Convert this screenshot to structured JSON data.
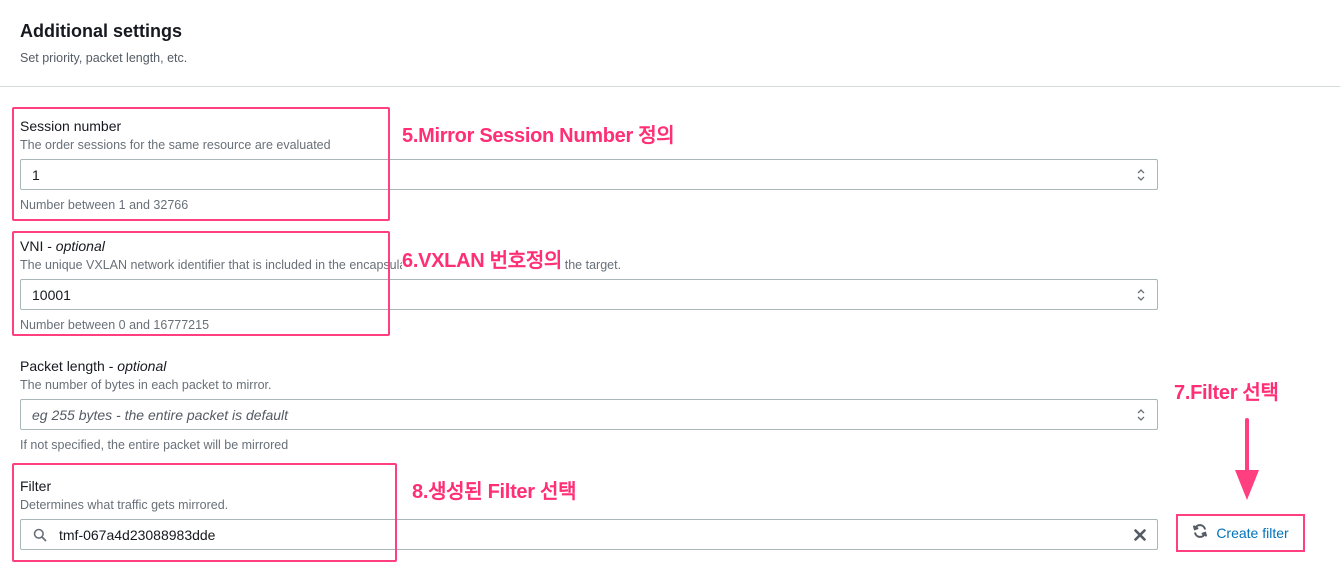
{
  "section": {
    "title": "Additional settings",
    "description": "Set priority, packet length, etc."
  },
  "session_number": {
    "label": "Session number",
    "description": "The order sessions for the same resource are evaluated",
    "value": "1",
    "hint": "Number between 1 and 32766"
  },
  "vni": {
    "label": "VNI",
    "optional": "optional",
    "description": "The unique VXLAN network identifier that is included in the encapsulated mirrored packets sent to the target.",
    "value": "10001",
    "hint": "Number between 0 and 16777215"
  },
  "packet_length": {
    "label": "Packet length",
    "optional": "optional",
    "description": "The number of bytes in each packet to mirror.",
    "placeholder": "eg 255 bytes - the entire packet is default",
    "hint": "If not specified, the entire packet will be mirrored"
  },
  "filter": {
    "label": "Filter",
    "description": "Determines what traffic gets mirrored.",
    "value": "tmf-067a4d23088983dde",
    "create_button": "Create filter"
  },
  "annotations": {
    "step5": "5.Mirror Session Number 정의",
    "step6": "6.VXLAN 번호정의",
    "step7": "7.Filter 선택",
    "step8": "8.생성된 Filter 선택"
  },
  "colors": {
    "highlight": "#ff3f7f",
    "link": "#0073bb"
  },
  "icons": {
    "spinner": "number-spinner-icon",
    "search": "search-icon",
    "clear": "clear-icon",
    "refresh": "refresh-icon",
    "arrow": "down-arrow-icon"
  }
}
